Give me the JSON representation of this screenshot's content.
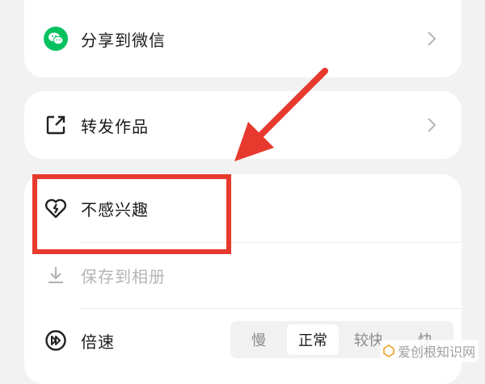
{
  "share_card": {
    "wechat_label": "分享到微信"
  },
  "forward_card": {
    "forward_label": "转发作品"
  },
  "more_card": {
    "dislike_label": "不感兴趣",
    "save_label": "保存到相册",
    "speed_label": "倍速",
    "speed_options": [
      "慢",
      "正常",
      "较快",
      "快"
    ],
    "speed_selected": "正常"
  },
  "watermark": {
    "text": "爱创根知识网"
  },
  "colors": {
    "annotation_red": "#e8392e",
    "wechat_green": "#07c160"
  }
}
